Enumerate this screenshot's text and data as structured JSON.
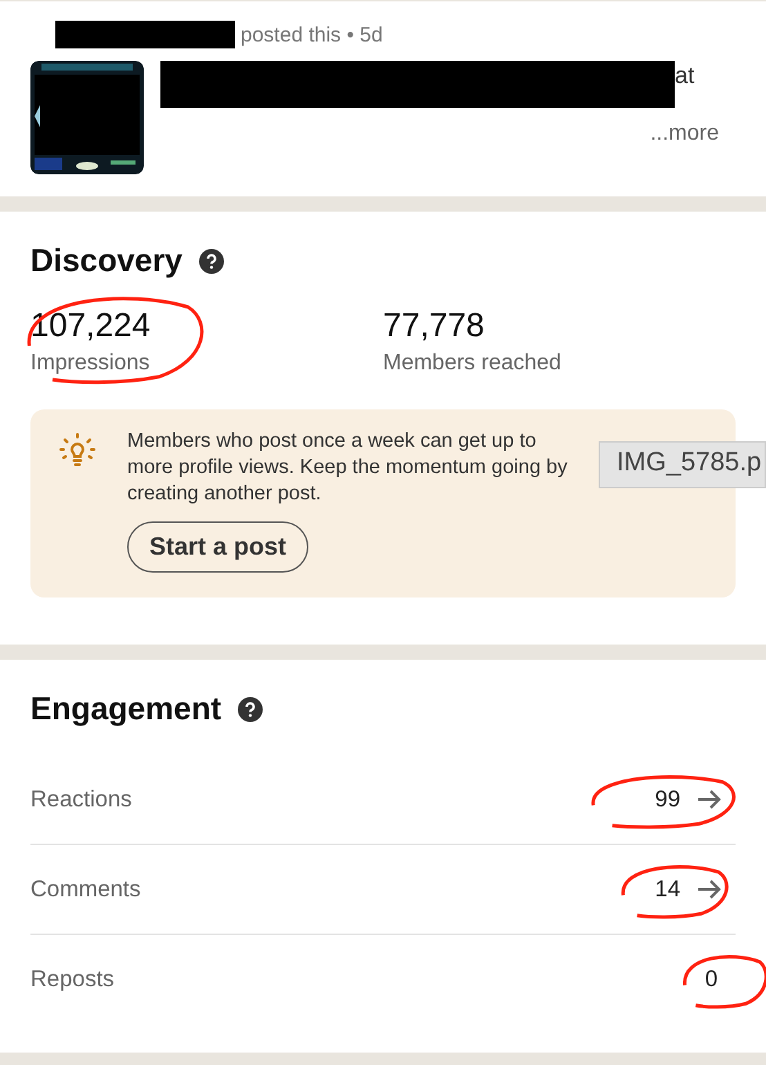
{
  "post": {
    "meta": "posted this • 5d",
    "text_fragment": "at",
    "more": "...more"
  },
  "discovery": {
    "title": "Discovery",
    "metrics": [
      {
        "value": "107,224",
        "label": "Impressions",
        "circled": true
      },
      {
        "value": "77,778",
        "label": "Members reached",
        "circled": false
      }
    ],
    "tip": {
      "text": "Members who post once a week can get up to  more profile views. Keep the momentum going by creating another post.",
      "button": "Start a post"
    }
  },
  "tooltip": "IMG_5785.p",
  "engagement": {
    "title": "Engagement",
    "rows": [
      {
        "label": "Reactions",
        "value": "99",
        "has_arrow": true,
        "circled": true
      },
      {
        "label": "Comments",
        "value": "14",
        "has_arrow": true,
        "circled": true
      },
      {
        "label": "Reposts",
        "value": "0",
        "has_arrow": false,
        "circled": true
      }
    ]
  }
}
